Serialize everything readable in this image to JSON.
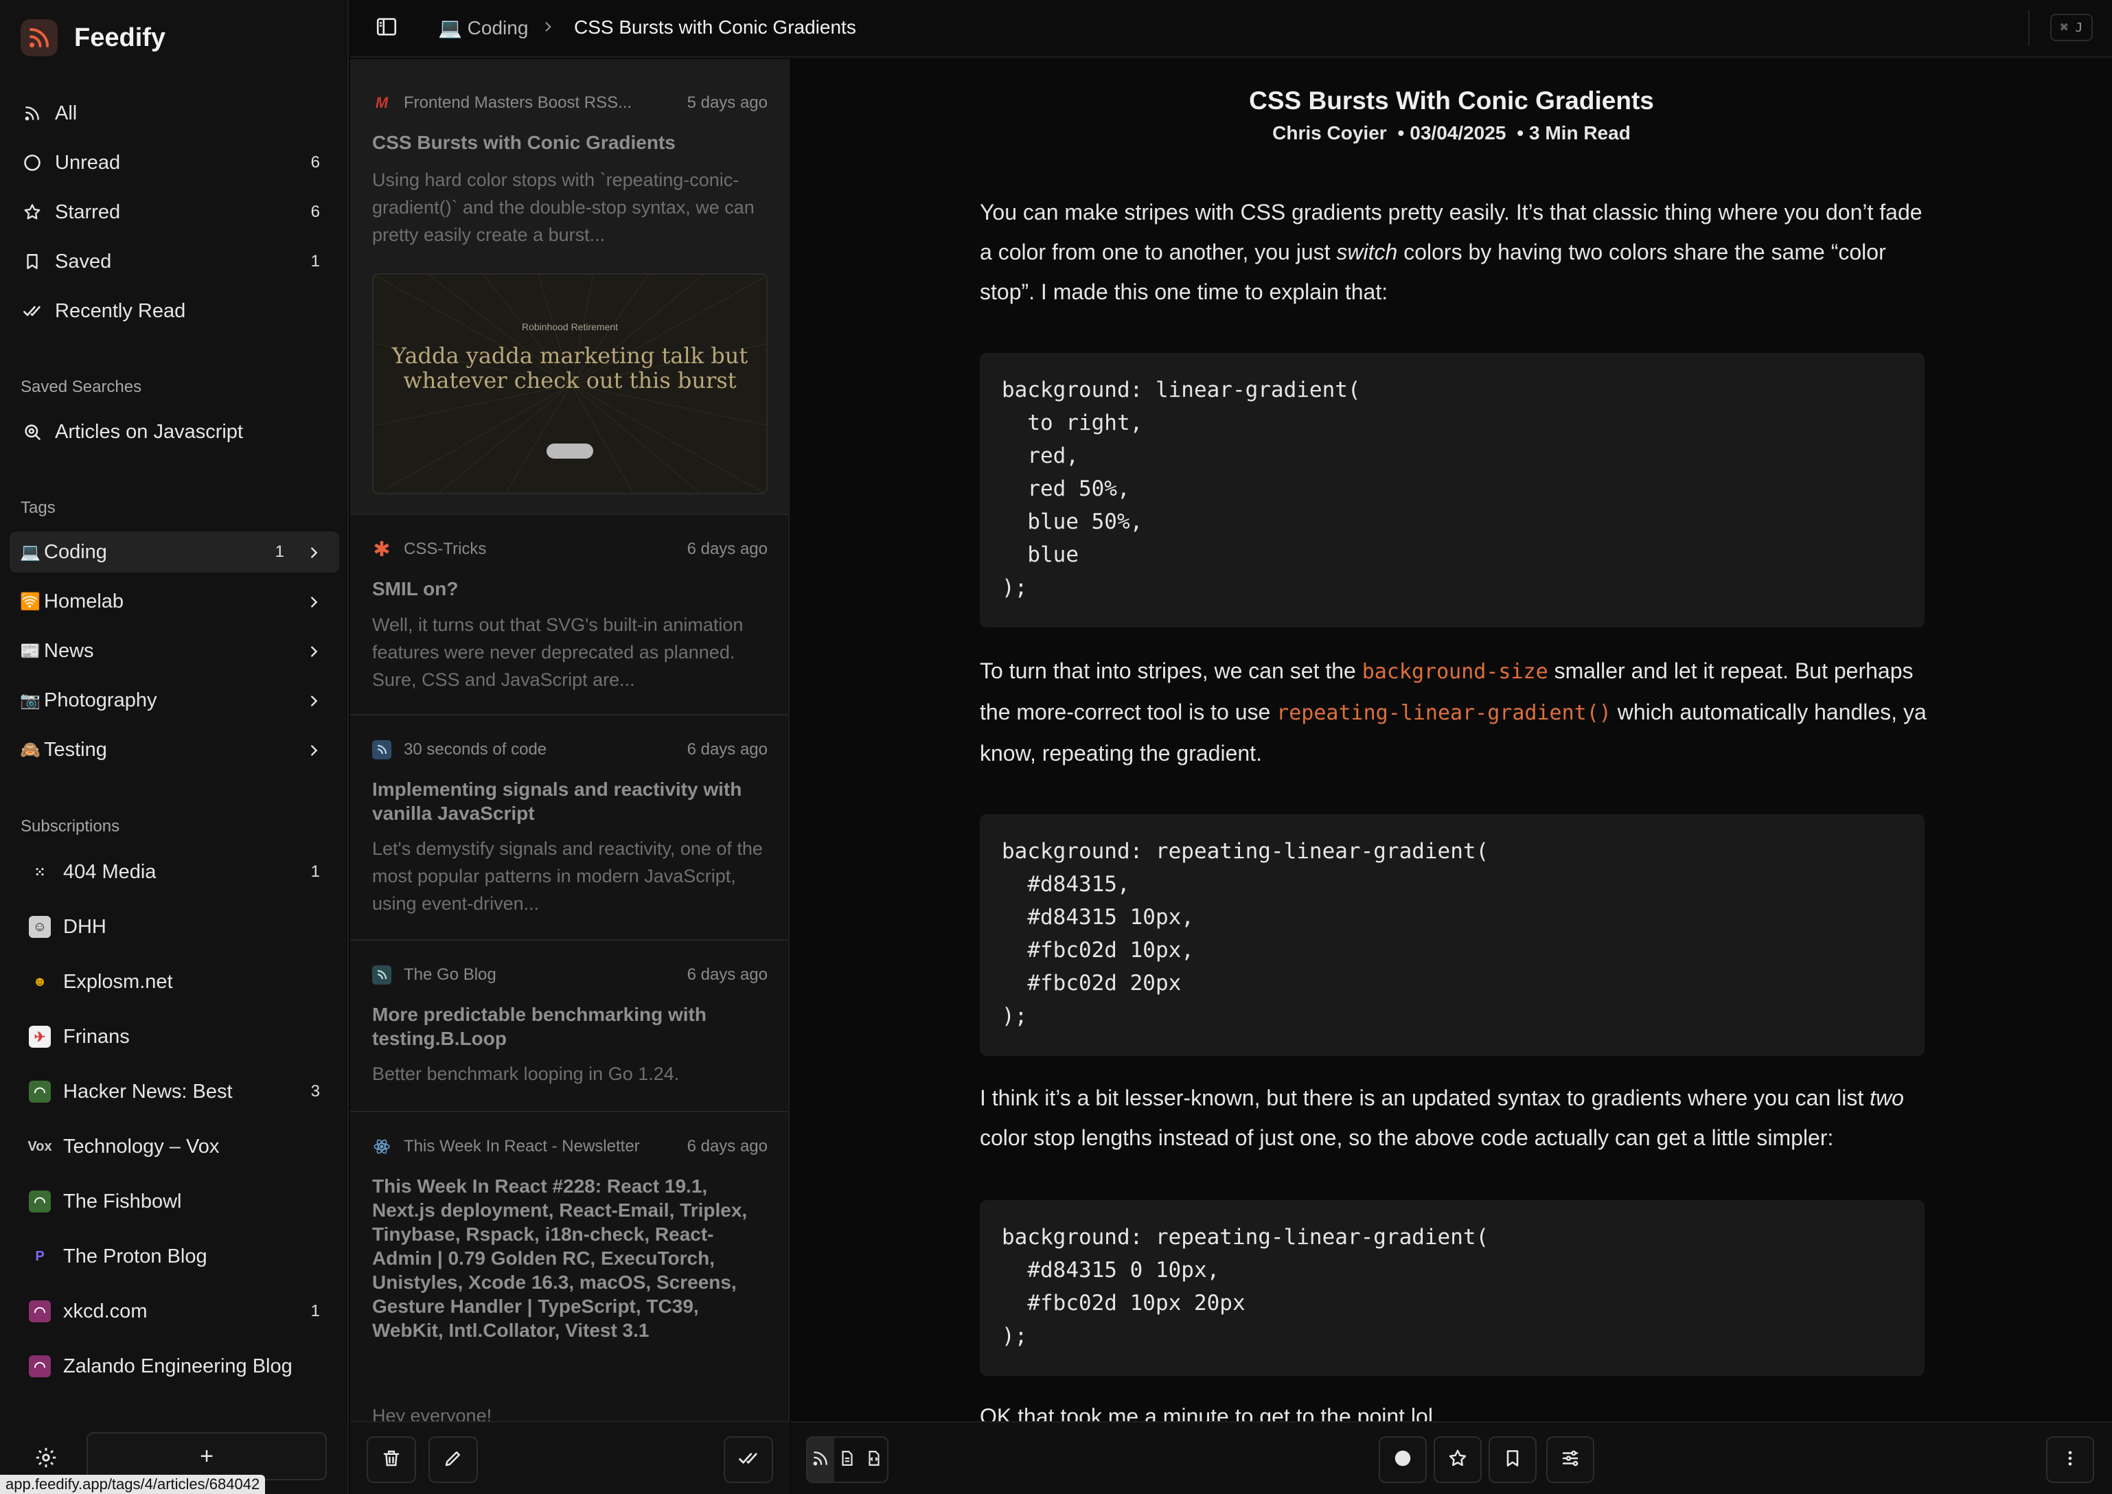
{
  "app": {
    "name": "Feedify"
  },
  "sidebar": {
    "nav": [
      {
        "label": "All",
        "icon": "rss-icon",
        "count": ""
      },
      {
        "label": "Unread",
        "icon": "circle-icon",
        "count": "6"
      },
      {
        "label": "Starred",
        "icon": "star-icon",
        "count": "6"
      },
      {
        "label": "Saved",
        "icon": "bookmark-icon",
        "count": "1"
      },
      {
        "label": "Recently Read",
        "icon": "double-check-icon",
        "count": ""
      }
    ],
    "saved_searches_label": "Saved Searches",
    "saved_searches": [
      {
        "label": "Articles on Javascript",
        "icon": "search-icon"
      }
    ],
    "tags_label": "Tags",
    "tags": [
      {
        "emoji": "💻",
        "label": "Coding",
        "count": "1"
      },
      {
        "emoji": "🛜",
        "label": "Homelab",
        "count": ""
      },
      {
        "emoji": "📰",
        "label": "News",
        "count": ""
      },
      {
        "emoji": "📷",
        "label": "Photography",
        "count": ""
      },
      {
        "emoji": "🙈",
        "label": "Testing",
        "count": ""
      }
    ],
    "subscriptions_label": "Subscriptions",
    "subscriptions": [
      {
        "label": "404 Media",
        "count": "1",
        "icon_char": "⁙",
        "color": "#ffffff",
        "bg": "#121212"
      },
      {
        "label": "DHH",
        "count": "",
        "icon_char": "☺",
        "color": "#222222",
        "bg": "#cfcfcf"
      },
      {
        "label": "Explosm.net",
        "count": "",
        "icon_char": "☻",
        "color": "#d9a400",
        "bg": "#121212"
      },
      {
        "label": "Frinans",
        "count": "",
        "icon_char": "✈",
        "color": "#d23a3a",
        "bg": "#f2f2f2"
      },
      {
        "label": "Hacker News: Best",
        "count": "3",
        "icon_char": "◠",
        "color": "#ffffff",
        "bg": "#3b6b34"
      },
      {
        "label": "Technology – Vox",
        "count": "",
        "icon_char": "Vox",
        "color": "#cccccc",
        "bg": "#121212"
      },
      {
        "label": "The Fishbowl",
        "count": "",
        "icon_char": "◠",
        "color": "#ffffff",
        "bg": "#3b6b34"
      },
      {
        "label": "The Proton Blog",
        "count": "",
        "icon_char": "P",
        "color": "#7b6cf6",
        "bg": "#121212"
      },
      {
        "label": "xkcd.com",
        "count": "1",
        "icon_char": "◠",
        "color": "#ffffff",
        "bg": "#8a2f6e"
      },
      {
        "label": "Zalando Engineering Blog",
        "count": "",
        "icon_char": "◠",
        "color": "#ffffff",
        "bg": "#8a2f6e"
      }
    ],
    "add_label": "+",
    "status_url": "app.feedify.app/tags/4/articles/684042"
  },
  "topbar": {
    "crumb_tag_emoji": "💻",
    "crumb_tag": "Coding",
    "crumb_article": "CSS Bursts with Conic Gradients",
    "shortcut": "⌘ J"
  },
  "list": [
    {
      "source": "Frontend Masters Boost RSS...",
      "age": "5 days ago",
      "title": "CSS Bursts with Conic Gradients",
      "excerpt": "Using hard color stops with `repeating-conic-gradient()` and the double-stop syntax, we can pretty easily create a burst...",
      "thumb_brand": "Robinhood Retirement",
      "thumb_headline": "Yadda yadda marketing talk but whatever check out this burst"
    },
    {
      "source": "CSS-Tricks",
      "age": "6 days ago",
      "title": "SMIL on?",
      "excerpt": "Well, it turns out that SVG's built-in animation features were never deprecated as planned. Sure, CSS and JavaScript are..."
    },
    {
      "source": "30 seconds of code",
      "age": "6 days ago",
      "title": "Implementing signals and reactivity with vanilla JavaScript",
      "excerpt": "Let's demystify signals and reactivity, one of the most popular patterns in modern JavaScript, using event-driven..."
    },
    {
      "source": "The Go Blog",
      "age": "6 days ago",
      "title": "More predictable benchmarking with testing.B.Loop",
      "excerpt": "Better benchmark looping in Go 1.24."
    },
    {
      "source": "This Week In React - Newsletter",
      "age": "6 days ago",
      "title": "This Week In React #228: React 19.1, Next.js deployment, React-Email, Triplex, Tinybase, Rspack, i18n-check, React-Admin | 0.79 Golden RC, ExecuTorch, Unistyles, Xcode 16.3, macOS, Screens, Gesture Handler | TypeScript, TC39, WebKit, Intl.Collator, Vitest 3.1",
      "excerpt": "Hey everyone!"
    }
  ],
  "article": {
    "title": "CSS Bursts With Conic Gradients",
    "author": "Chris Coyier",
    "date": "03/04/2025",
    "read_time": "3 Min Read",
    "p1_a": "You can make stripes with CSS gradients pretty easily. It’s that classic thing where you don’t fade a color from one to another, you just ",
    "p1_em": "switch",
    "p1_b": " colors by having two colors share the same “color stop”. I made this one time to explain that:",
    "code1": "background: linear-gradient(\n  to right,\n  red,\n  red 50%,\n  blue 50%,\n  blue\n);",
    "p2_a": "To turn that into stripes, we can set the ",
    "p2_code1": "background-size",
    "p2_b": " smaller and let it repeat. But perhaps the more-correct tool is to use ",
    "p2_code2": "repeating-linear-gradient()",
    "p2_c": " which automatically handles, ya know, repeating the gradient.",
    "code2": "background: repeating-linear-gradient(\n  #d84315,\n  #d84315 10px,\n  #fbc02d 10px,\n  #fbc02d 20px\n);",
    "p3_a": "I think it’s a bit lesser-known, but there is an updated syntax to gradients where you can list ",
    "p3_em": "two",
    "p3_b": " color stop lengths instead of just one, so the above code actually can get a little simpler:",
    "code3": "background: repeating-linear-gradient(\n  #d84315 0 10px,\n  #fbc02d 10px 20px\n);",
    "p4": "OK that took me a minute to get to the point lol."
  },
  "colors": {
    "accent_code": "#e0703a",
    "brand": "#e8613c"
  }
}
